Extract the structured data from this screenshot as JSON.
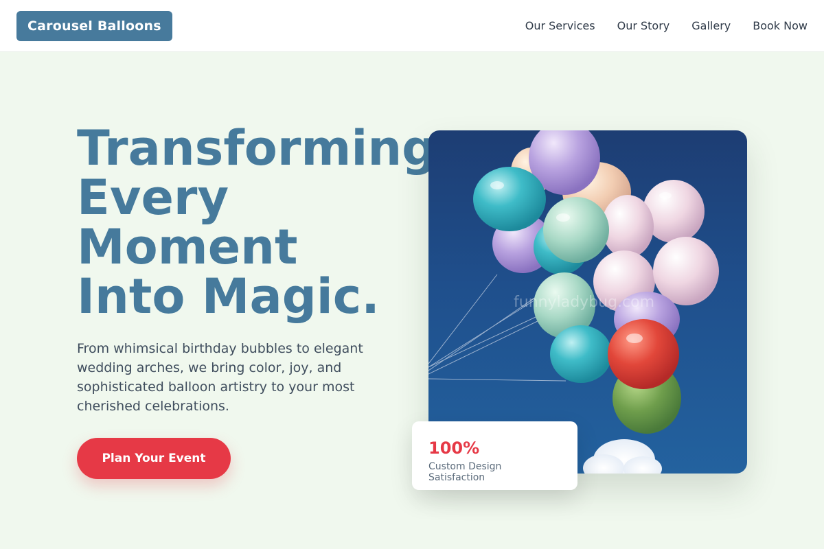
{
  "brand": {
    "name": "Carousel Balloons",
    "color": "#477a9c"
  },
  "nav": {
    "links": [
      "Our Services",
      "Our Story",
      "Gallery",
      "Book Now"
    ]
  },
  "hero": {
    "title_lines": [
      "Transforming",
      "Every",
      "Moment",
      "Into Magic."
    ],
    "description": "From whimsical birthday bubbles to elegant wedding arches, we bring color, joy, and sophisticated balloon artistry to your most cherished celebrations.",
    "cta_label": "Plan Your Event",
    "image_watermark": "funnyladybug.com"
  },
  "stat": {
    "value": "100%",
    "label": "Custom Design Satisfaction"
  },
  "colors": {
    "accent": "#e63946",
    "title": "#467a9c",
    "background": "#f0f8ee"
  }
}
